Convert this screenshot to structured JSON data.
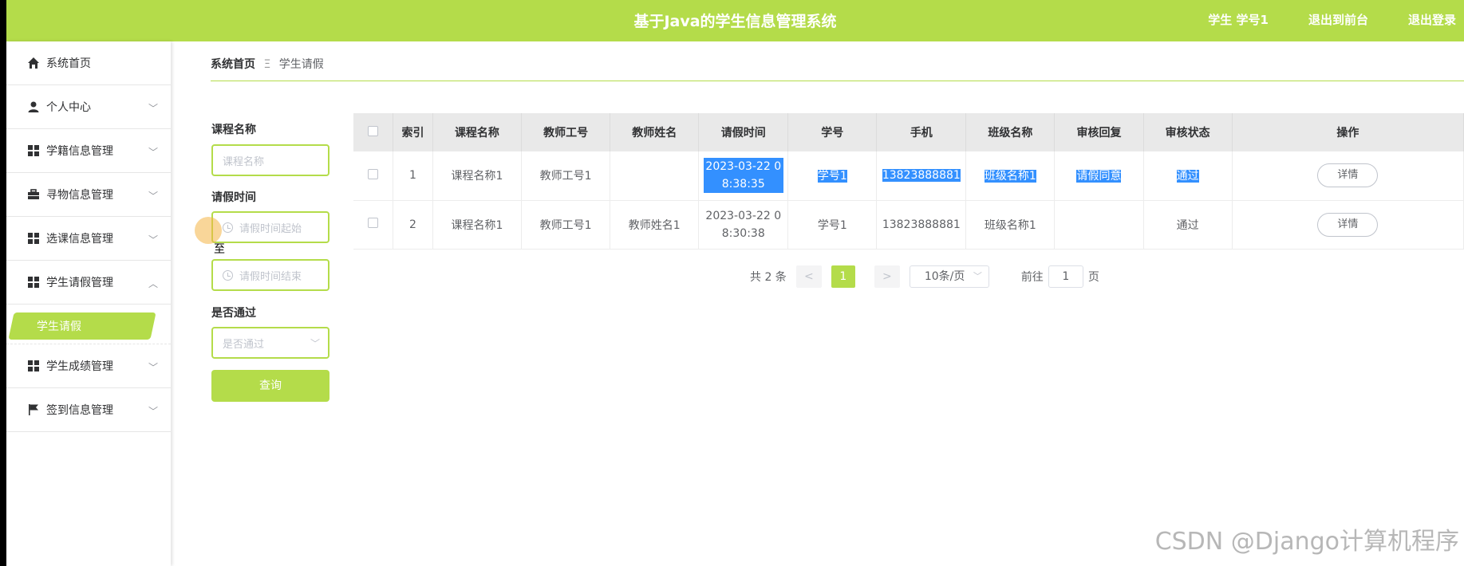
{
  "header": {
    "title": "基于Java的学生信息管理系统",
    "user": "学生 学号1",
    "back_front": "退出到前台",
    "logout": "退出登录",
    "bg_color": "#b4dc4a"
  },
  "sidebar": {
    "items": [
      {
        "label": "系统首页",
        "icon": "home-icon"
      },
      {
        "label": "个人中心",
        "icon": "user-icon"
      },
      {
        "label": "学籍信息管理",
        "icon": "grid-icon"
      },
      {
        "label": "寻物信息管理",
        "icon": "briefcase-icon"
      },
      {
        "label": "选课信息管理",
        "icon": "grid-icon"
      },
      {
        "label": "学生请假管理",
        "icon": "grid-icon"
      },
      {
        "label": "学生成绩管理",
        "icon": "grid-icon"
      },
      {
        "label": "签到信息管理",
        "icon": "flag-icon"
      }
    ],
    "active_sub": "学生请假"
  },
  "breadcrumb": {
    "home": "系统首页",
    "sep": "Ξ",
    "current": "学生请假"
  },
  "filters": {
    "course_label": "课程名称",
    "course_placeholder": "课程名称",
    "time_label": "请假时间",
    "time_start_placeholder": "请假时间起始",
    "time_end_placeholder": "请假时间结束",
    "time_to": "至",
    "pass_label": "是否通过",
    "pass_placeholder": "是否通过",
    "search": "查询"
  },
  "table": {
    "columns": [
      "索引",
      "课程名称",
      "教师工号",
      "教师姓名",
      "请假时间",
      "学号",
      "手机",
      "班级名称",
      "审核回复",
      "审核状态",
      "操作"
    ],
    "rows": [
      {
        "index": "1",
        "course": "课程名称1",
        "teacher_no": "教师工号1",
        "teacher_name": "",
        "time_a": "2023-03-22 0",
        "time_b": "8:38:35",
        "student_no": "学号1",
        "phone": "13823888881",
        "class": "班级名称1",
        "reply": "请假同意",
        "status": "通过",
        "action": "详情"
      },
      {
        "index": "2",
        "course": "课程名称1",
        "teacher_no": "教师工号1",
        "teacher_name": "教师姓名1",
        "time_a": "2023-03-22 0",
        "time_b": "8:30:38",
        "student_no": "学号1",
        "phone": "13823888881",
        "class": "班级名称1",
        "reply": "",
        "status": "通过",
        "action": "详情"
      }
    ]
  },
  "pagination": {
    "total": "共 2 条",
    "prev": "<",
    "current": "1",
    "next": ">",
    "size": "10条/页",
    "goto": "前往",
    "page_input": "1",
    "page_unit": "页"
  },
  "watermark": "CSDN @Django计算机程序"
}
